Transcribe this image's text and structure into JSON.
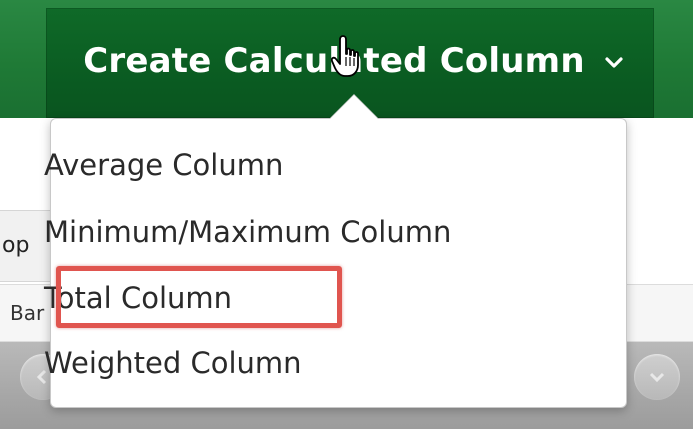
{
  "toolbar": {
    "create_button_label": "Create Calculated Column"
  },
  "menu": {
    "items": [
      {
        "label": "Average Column"
      },
      {
        "label": "Minimum/Maximum Column"
      },
      {
        "label": "Total Column"
      },
      {
        "label": "Weighted Column"
      }
    ],
    "highlighted": "Total Column"
  },
  "background": {
    "left_tab_text": "op",
    "row_text": "Bar"
  },
  "colors": {
    "action_bar": "#1f7a36",
    "button": "#0a5a21",
    "highlight": "#e0554f"
  },
  "icons": {
    "chevron": "chevron-down-icon",
    "cursor": "hand-pointer-icon"
  }
}
